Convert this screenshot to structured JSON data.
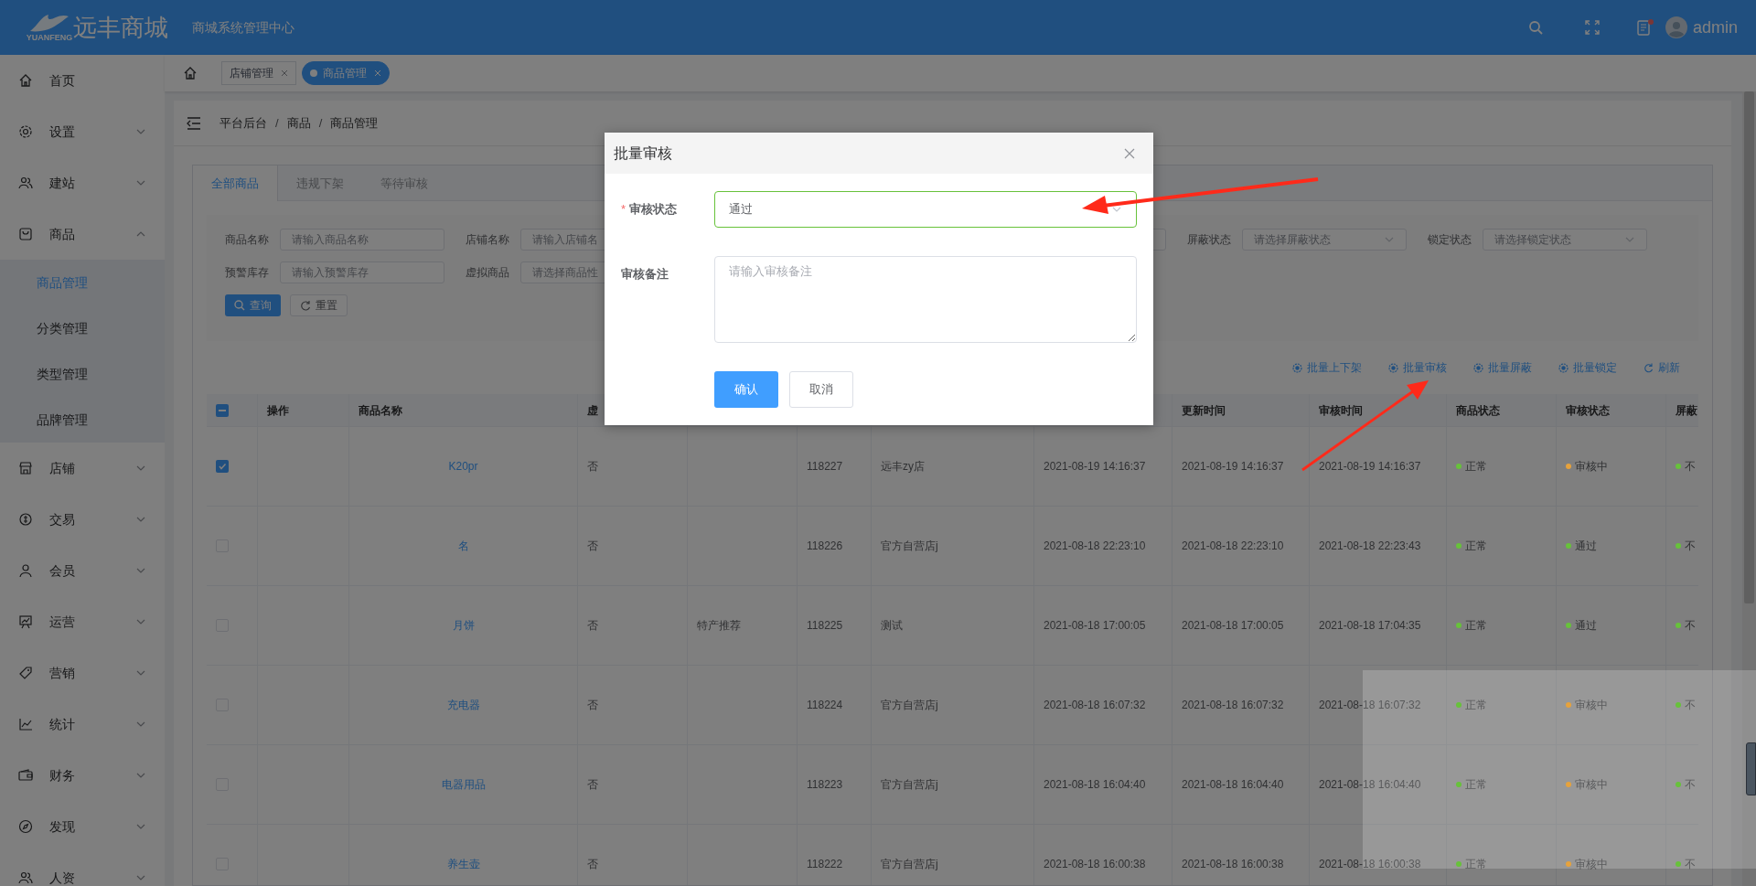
{
  "header": {
    "brand": "远丰商城",
    "logo_caption": "YUANFENG",
    "subtitle": "商城系统管理中心",
    "user": "admin"
  },
  "sidebar": {
    "items": [
      {
        "label": "首页",
        "kind": "link"
      },
      {
        "label": "设置",
        "kind": "group",
        "expanded": false
      },
      {
        "label": "建站",
        "kind": "group",
        "expanded": false
      },
      {
        "label": "商品",
        "kind": "group",
        "expanded": true,
        "children": [
          {
            "label": "商品管理",
            "selected": true
          },
          {
            "label": "分类管理",
            "selected": false
          },
          {
            "label": "类型管理",
            "selected": false
          },
          {
            "label": "品牌管理",
            "selected": false
          }
        ]
      },
      {
        "label": "店铺",
        "kind": "group",
        "expanded": false
      },
      {
        "label": "交易",
        "kind": "group",
        "expanded": false
      },
      {
        "label": "会员",
        "kind": "group",
        "expanded": false
      },
      {
        "label": "运营",
        "kind": "group",
        "expanded": false
      },
      {
        "label": "营销",
        "kind": "group",
        "expanded": false
      },
      {
        "label": "统计",
        "kind": "group",
        "expanded": false
      },
      {
        "label": "财务",
        "kind": "group",
        "expanded": false
      },
      {
        "label": "发现",
        "kind": "group",
        "expanded": false
      },
      {
        "label": "人资",
        "kind": "group",
        "expanded": false
      }
    ]
  },
  "open_tabs": [
    {
      "label": "店铺管理",
      "selected": false
    },
    {
      "label": "商品管理",
      "selected": true
    }
  ],
  "breadcrumb": [
    {
      "kind": "item",
      "label": "平台后台"
    },
    {
      "kind": "separator",
      "label": "/"
    },
    {
      "kind": "item",
      "label": "商品"
    },
    {
      "kind": "separator",
      "label": "/"
    },
    {
      "kind": "item",
      "label": "商品管理"
    }
  ],
  "page_tabs": [
    {
      "label": "全部商品",
      "selected": true
    },
    {
      "label": "违规下架",
      "selected": false
    },
    {
      "label": "等待审核",
      "selected": false
    }
  ],
  "filters": [
    [
      {
        "kind": "input",
        "label": "商品名称",
        "placeholder": "请输入商品名称"
      },
      {
        "kind": "input",
        "label": "店铺名称",
        "placeholder": "请输入店铺名"
      },
      {
        "kind": "covered"
      },
      {
        "kind": "select"
      },
      {
        "kind": "select",
        "label": "屏蔽状态",
        "placeholder": "请选择屏蔽状态"
      },
      {
        "kind": "select",
        "label": "锁定状态",
        "placeholder": "请选择锁定状态"
      }
    ],
    [
      {
        "kind": "input",
        "label": "预警库存",
        "placeholder": "请输入预警库存"
      },
      {
        "kind": "select",
        "label": "虚拟商品",
        "placeholder": "请选择商品性"
      }
    ]
  ],
  "filter_buttons": [
    {
      "label": "查询",
      "kind": "primary"
    },
    {
      "label": "重置",
      "kind": "default"
    }
  ],
  "actions": [
    {
      "label": "批量上下架",
      "kind": "batch"
    },
    {
      "label": "批量审核",
      "kind": "batch"
    },
    {
      "label": "批量屏蔽",
      "kind": "batch"
    },
    {
      "label": "批量锁定",
      "kind": "batch"
    },
    {
      "label": "刷新",
      "kind": "refresh"
    }
  ],
  "table": {
    "indeterminate": true,
    "columns": [
      "操作",
      "商品名称",
      "虚",
      "更新时间",
      "审核时间",
      "商品状态",
      "审核状态",
      "屏蔽"
    ],
    "rows": [
      {
        "selected": true,
        "name": "K20pr",
        "virtual": "否",
        "id": "118227",
        "shop": "远丰zy店",
        "created": "2021-08-19 14:16:37",
        "updated": "2021-08-19 14:16:37",
        "audited": "2021-08-19 14:16:37",
        "product_status": {
          "label": "正常",
          "color": "#67c23a"
        },
        "audit_status": {
          "label": "审核中",
          "color": "#e6a23c"
        },
        "shield": {
          "label": "不",
          "color": "#67c23a"
        }
      },
      {
        "selected": false,
        "name": "名",
        "virtual": "否",
        "id": "118226",
        "shop": "官方自营店j",
        "created": "2021-08-18 22:23:10",
        "updated": "2021-08-18 22:23:10",
        "audited": "2021-08-18 22:23:43",
        "product_status": {
          "label": "正常",
          "color": "#67c23a"
        },
        "audit_status": {
          "label": "通过",
          "color": "#67c23a"
        },
        "shield": {
          "label": "不",
          "color": "#67c23a"
        }
      },
      {
        "selected": false,
        "name": "月饼",
        "virtual": "否",
        "tag": "特产推荐",
        "id": "118225",
        "shop": "测试",
        "created": "2021-08-18 17:00:05",
        "updated": "2021-08-18 17:00:05",
        "audited": "2021-08-18 17:04:35",
        "product_status": {
          "label": "正常",
          "color": "#67c23a"
        },
        "audit_status": {
          "label": "通过",
          "color": "#67c23a"
        },
        "shield": {
          "label": "不",
          "color": "#67c23a"
        }
      },
      {
        "selected": false,
        "name": "充电器",
        "virtual": "否",
        "id": "118224",
        "shop": "官方自营店j",
        "created": "2021-08-18 16:07:32",
        "updated": "2021-08-18 16:07:32",
        "audited": "2021-08-18 16:07:32",
        "product_status": {
          "label": "正常",
          "color": "#67c23a"
        },
        "audit_status": {
          "label": "审核中",
          "color": "#e6a23c"
        },
        "shield": {
          "label": "不",
          "color": "#67c23a"
        }
      },
      {
        "selected": false,
        "name": "电器用品",
        "virtual": "否",
        "id": "118223",
        "shop": "官方自营店j",
        "created": "2021-08-18 16:04:40",
        "updated": "2021-08-18 16:04:40",
        "audited": "2021-08-18 16:04:40",
        "product_status": {
          "label": "正常",
          "color": "#67c23a"
        },
        "audit_status": {
          "label": "审核中",
          "color": "#e6a23c"
        },
        "shield": {
          "label": "不",
          "color": "#67c23a"
        }
      },
      {
        "selected": false,
        "name": "养生壶",
        "virtual": "否",
        "id": "118222",
        "shop": "官方自营店j",
        "created": "2021-08-18 16:00:38",
        "updated": "2021-08-18 16:00:38",
        "audited": "2021-08-18 16:00:38",
        "product_status": {
          "label": "正常",
          "color": "#67c23a"
        },
        "audit_status": {
          "label": "审核中",
          "color": "#e6a23c"
        },
        "shield": {
          "label": "不",
          "color": "#67c23a"
        }
      }
    ]
  },
  "dialog": {
    "title": "批量审核",
    "fields": [
      {
        "kind": "select",
        "label": "审核状态",
        "required_mark": "*",
        "valid": true,
        "value": "通过"
      },
      {
        "kind": "textarea",
        "label": "审核备注",
        "valid": false,
        "placeholder": "请输入审核备注"
      }
    ],
    "buttons": [
      {
        "label": "确认",
        "kind": "primary"
      },
      {
        "label": "取消",
        "kind": "default"
      }
    ]
  }
}
